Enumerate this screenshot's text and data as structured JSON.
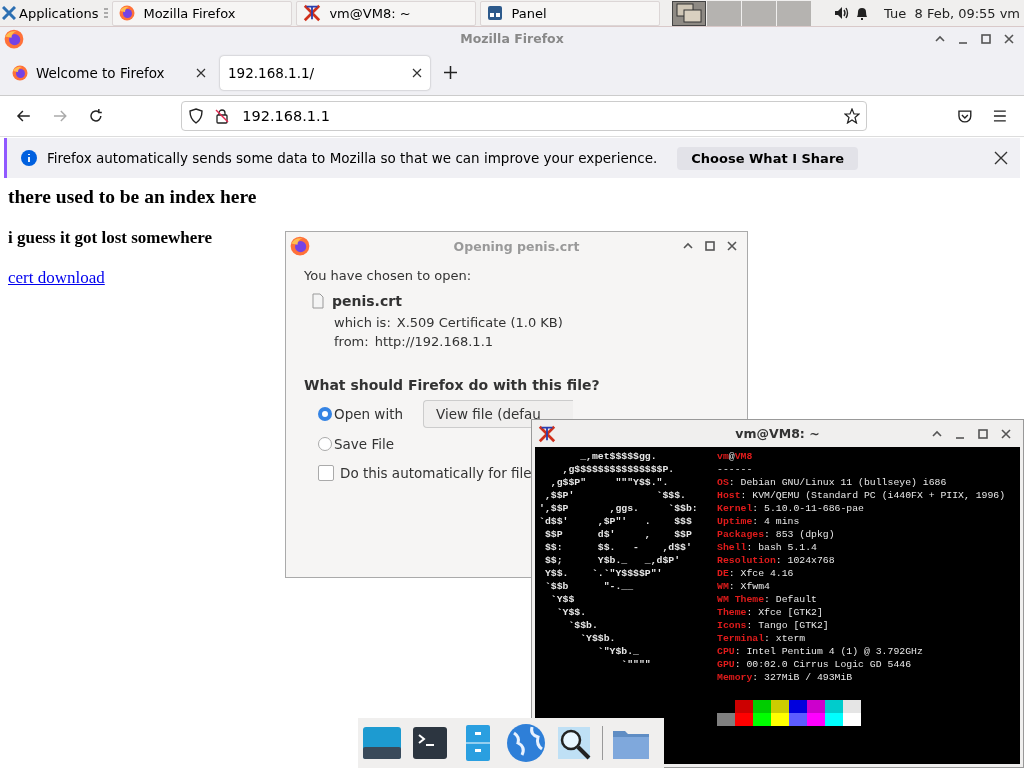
{
  "panel": {
    "menu_label": "Applications",
    "tasks": [
      {
        "label": "Mozilla Firefox",
        "kind": "firefox"
      },
      {
        "label": "vm@VM8: ~",
        "kind": "xterm"
      },
      {
        "label": "Panel",
        "kind": "panel"
      }
    ],
    "workspaces": [
      {
        "selected": true
      },
      {
        "selected": false
      },
      {
        "selected": false
      },
      {
        "selected": false
      }
    ],
    "clock": "Tue  8 Feb, 09:55",
    "user": "vm"
  },
  "browser": {
    "title": "Mozilla Firefox",
    "tabs": [
      {
        "label": "Welcome to Firefox",
        "selected": false,
        "kind": "firefox"
      },
      {
        "label": "192.168.1.1/",
        "selected": true,
        "kind": "plain"
      }
    ],
    "nav": [
      {
        "kind": "back",
        "disabled": false
      },
      {
        "kind": "forward",
        "disabled": true
      },
      {
        "kind": "reload",
        "disabled": false
      }
    ],
    "url": "192.168.1.1",
    "notice": {
      "text": "Firefox automatically sends some data to Mozilla so that we can improve your experience.",
      "button": "Choose What I Share"
    },
    "page": {
      "heading": "there used to be an index here",
      "subheading": "i guess it got lost somewhere",
      "link": "cert download"
    }
  },
  "dialog": {
    "title": "Opening penis.crt",
    "intro": "You have chosen to open:",
    "filename": "penis.crt",
    "details": [
      {
        "label": "which is:",
        "value": "X.509 Certificate (1.0 KB)"
      },
      {
        "label": "from:",
        "value": "http://192.168.1.1"
      }
    ],
    "question": "What should Firefox do with this file?",
    "options": [
      {
        "label": "Open with",
        "selected": true
      },
      {
        "label": "Save File",
        "selected": false
      }
    ],
    "app_select": "View file (defau",
    "auto_checkbox": {
      "label": "Do this automatically for file",
      "checked": false
    }
  },
  "terminal": {
    "title": "vm@VM8: ~",
    "art": [
      "       _,met$$$$$gg.",
      "    ,g$$$$$$$$$$$$$$$P.",
      "  ,g$$P\"     \"\"\"Y$$.\".",
      " ,$$P'              `$$$.",
      "',$$P       ,ggs.     `$$b:",
      "`d$$'     ,$P\"'   .    $$$",
      " $$P      d$'     ,    $$P",
      " $$:      $$.   -    ,d$$'",
      " $$;      Y$b._   _,d$P'",
      " Y$$.    `.`\"Y$$$$P\"'",
      " `$$b      \"-.__",
      "  `Y$$",
      "   `Y$$.",
      "     `$$b.",
      "       `Y$$b.",
      "          `\"Y$b._",
      "              `\"\"\"\""
    ],
    "header": [
      {
        "text": "vm",
        "kind": "accent"
      },
      {
        "text": "@",
        "kind": "plain"
      },
      {
        "text": "VM8",
        "kind": "accent"
      }
    ],
    "rule": "------",
    "info": [
      {
        "key": "OS",
        "value": ": Debian GNU/Linux 11 (bullseye) i686"
      },
      {
        "key": "Host",
        "value": ": KVM/QEMU (Standard PC (i440FX + PIIX, 1996)"
      },
      {
        "key": "Kernel",
        "value": ": 5.10.0-11-686-pae"
      },
      {
        "key": "Uptime",
        "value": ": 4 mins"
      },
      {
        "key": "Packages",
        "value": ": 853 (dpkg)"
      },
      {
        "key": "Shell",
        "value": ": bash 5.1.4"
      },
      {
        "key": "Resolution",
        "value": ": 1024x768"
      },
      {
        "key": "DE",
        "value": ": Xfce 4.16"
      },
      {
        "key": "WM",
        "value": ": Xfwm4"
      },
      {
        "key": "WM Theme",
        "value": ": Default"
      },
      {
        "key": "Theme",
        "value": ": Xfce [GTK2]"
      },
      {
        "key": "Icons",
        "value": ": Tango [GTK2]"
      },
      {
        "key": "Terminal",
        "value": ": xterm"
      },
      {
        "key": "CPU",
        "value": ": Intel Pentium 4 (1) @ 3.792GHz"
      },
      {
        "key": "GPU",
        "value": ": 00:02.0 Cirrus Logic GD 5446"
      },
      {
        "key": "Memory",
        "value": ": 327MiB / 493MiB"
      }
    ]
  },
  "dock": [
    {
      "kind": "desktop"
    },
    {
      "kind": "terminal"
    },
    {
      "kind": "cabinet"
    },
    {
      "kind": "globe"
    },
    {
      "kind": "search"
    },
    {
      "kind": "separator"
    },
    {
      "kind": "folder"
    }
  ]
}
